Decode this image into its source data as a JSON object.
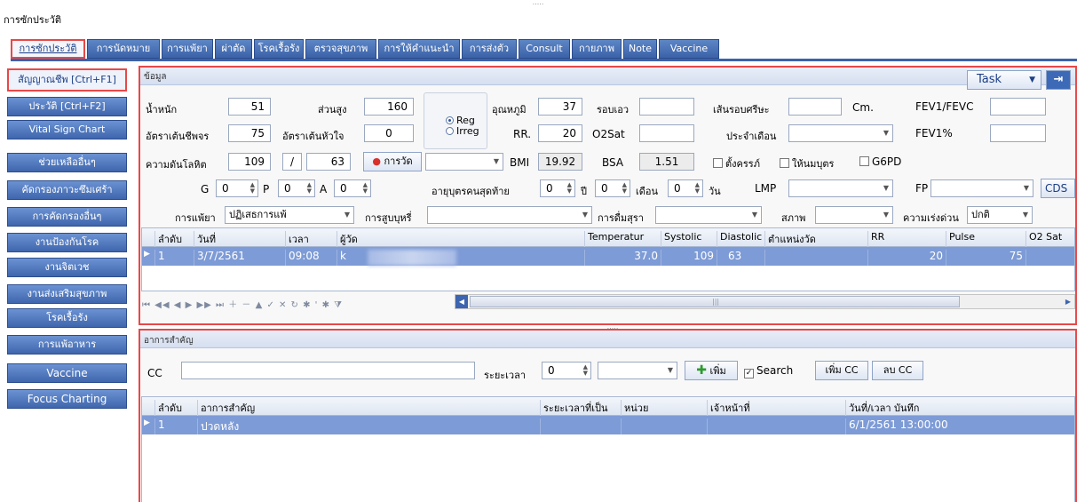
{
  "window": {
    "title": "การซักประวัติ",
    "grip": "....."
  },
  "tabs": [
    {
      "label": "การซักประวัติ"
    },
    {
      "label": "การนัดหมาย"
    },
    {
      "label": "การแพ้ยา"
    },
    {
      "label": "ผ่าตัด"
    },
    {
      "label": "โรคเรื้อรัง"
    },
    {
      "label": "ตรวจสุขภาพ"
    },
    {
      "label": "การให้คำแนะนำ"
    },
    {
      "label": "การส่งตัว"
    },
    {
      "label": "Consult"
    },
    {
      "label": "กายภาพ"
    },
    {
      "label": "Note"
    },
    {
      "label": "Vaccine"
    }
  ],
  "sidebar": [
    {
      "label": "สัญญาณชีพ [Ctrl+F1]"
    },
    {
      "label": "ประวัติ [Ctrl+F2]"
    },
    {
      "label": "Vital Sign Chart"
    },
    {
      "label": "ช่วยเหลืออื่นๆ"
    },
    {
      "label": "คัดกรองภาวะซึมเศร้า"
    },
    {
      "label": "การคัดกรองอื่นๆ"
    },
    {
      "label": "งานป้องกันโรค"
    },
    {
      "label": "งานจิตเวช"
    },
    {
      "label": "งานส่งเสริมสุขภาพ"
    },
    {
      "label": "โรคเรื้อรัง"
    },
    {
      "label": "การแพ้อาหาร"
    },
    {
      "label": "Vaccine"
    },
    {
      "label": "Focus Charting"
    }
  ],
  "panel1": {
    "title": "ข้อมูล",
    "task_label": "Task",
    "weight_label": "น้ำหนัก",
    "weight": "51",
    "height_label": "ส่วนสูง",
    "height": "160",
    "temp_label": "อุณหภูมิ",
    "temp": "37",
    "waist_label": "รอบเอว",
    "waist": "",
    "head_circ_label": "เส้นรอบศรีษะ",
    "head_circ": "",
    "cm_label": "Cm.",
    "fev1fvc_label": "FEV1/FEVC",
    "fev1fvc": "",
    "pulse_label": "อัตราเต้นชีพจร",
    "pulse": "75",
    "hr_label": "อัตราเต้นหัวใจ",
    "hr": "0",
    "rhythm_reg": "Reg",
    "rhythm_irreg": "Irreg",
    "rr_label": "RR.",
    "rr": "20",
    "o2sat_label": "O2Sat",
    "o2sat": "",
    "menses_label": "ประจำเดือน",
    "menses": "",
    "fev1pct_label": "FEV1%",
    "fev1pct": "",
    "bp_label": "ความดันโลหิต",
    "bp_sys": "109",
    "bp_sep": "/",
    "bp_dia": "63",
    "measure_btn": "การวัด",
    "measure_combo": "",
    "bmi_label": "BMI",
    "bmi": "19.92",
    "bsa_label": "BSA",
    "bsa": "1.51",
    "pregnant_label": "ตั้งครรภ์",
    "breastfeed_label": "ให้นมบุตร",
    "g6pd_label": "G6PD",
    "g_label": "G",
    "g": "0",
    "p_label": "P",
    "p": "0",
    "a_label": "A",
    "a": "0",
    "last_child_age_label": "อายุบุตรคนสุดท้าย",
    "last_child_year": "0",
    "year_label": "ปี",
    "last_child_month": "0",
    "month_label": "เดือน",
    "last_child_day": "0",
    "day_label": "วัน",
    "lmp_label": "LMP",
    "lmp": "",
    "fp_label": "FP",
    "fp": "",
    "cds_label": "CDS",
    "allergy_label": "การแพ้ยา",
    "allergy": "ปฏิเสธการแพ้",
    "smoking_label": "การสูบบุหรี่",
    "smoking": "",
    "alcohol_label": "การดื่มสุรา",
    "alcohol": "",
    "status_label": "สภาพ",
    "status": "",
    "urgency_label": "ความเร่งด่วน",
    "urgency": "ปกติ",
    "grid": {
      "headers": [
        "ลำดับ",
        "วันที่",
        "เวลา",
        "ผู้วัด",
        "Temperatur",
        "Systolic",
        "Diastolic",
        "ตำแหน่งวัด",
        "RR",
        "Pulse",
        "O2 Sat"
      ],
      "rows": [
        {
          "no": "1",
          "date": "3/7/2561",
          "time": "09:08",
          "by": "k",
          "temp": "37.0",
          "sys": "109",
          "dia": "63",
          "pos": "",
          "rr": "20",
          "pulse": "75",
          "o2": ""
        }
      ]
    },
    "navigator": "⏮ ◀◀ ◀ ▶ ▶▶ ⏭ ＋ － ▲ ✓ ✕ ↻ ✱ ' ✱ ⧩",
    "scroll_grip": "|||"
  },
  "panel2": {
    "title": "อาการสำคัญ",
    "cc_label": "CC",
    "cc": "",
    "duration_label": "ระยะเวลา",
    "duration": "0",
    "duration_unit": "",
    "add_label": "เพิ่ม",
    "search_label": "Search",
    "add_cc": "เพิ่ม CC",
    "del_cc": "ลบ CC",
    "grid": {
      "headers": [
        "ลำดับ",
        "อาการสำคัญ",
        "ระยะเวลาที่เป็น",
        "หน่วย",
        "เจ้าหน้าที่",
        "วันที่/เวลา บันทึก"
      ],
      "rows": [
        {
          "no": "1",
          "symptom": "ปวดหลัง",
          "duration": "",
          "unit": "",
          "staff": "",
          "datetime": "6/1/2561 13:00:00"
        }
      ]
    }
  }
}
